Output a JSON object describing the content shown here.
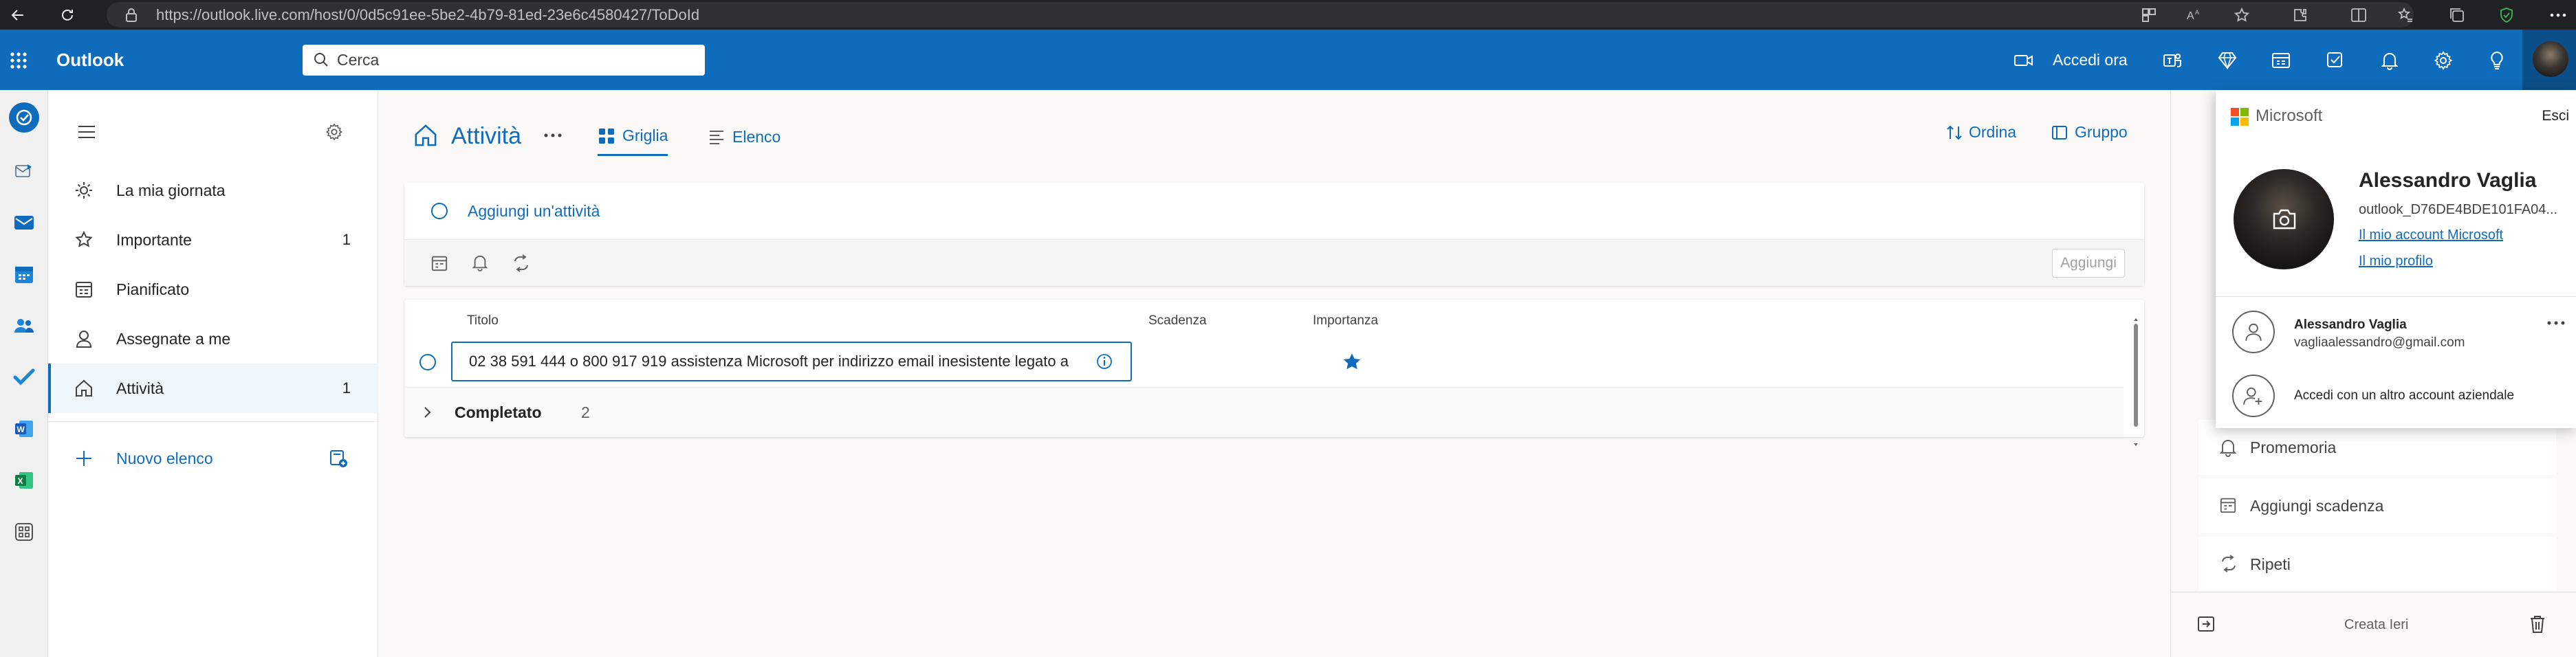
{
  "browser": {
    "url": "https://outlook.live.com/host/0/0d5c91ee-5be2-4b79-81ed-23e6c4580427/ToDoId"
  },
  "header": {
    "app_name": "Outlook",
    "search_placeholder": "Cerca",
    "signin_label": "Accedi ora"
  },
  "nav": {
    "items": [
      {
        "label": "La mia giornata",
        "count": "",
        "icon": "sun-icon"
      },
      {
        "label": "Importante",
        "count": "1",
        "icon": "star-icon"
      },
      {
        "label": "Pianificato",
        "count": "",
        "icon": "calendar-icon"
      },
      {
        "label": "Assegnate a me",
        "count": "",
        "icon": "person-icon"
      },
      {
        "label": "Attività",
        "count": "1",
        "icon": "home-icon",
        "selected": true
      }
    ],
    "new_list_label": "Nuovo elenco"
  },
  "main": {
    "title": "Attività",
    "tabs": [
      {
        "label": "Griglia",
        "active": true
      },
      {
        "label": "Elenco",
        "active": false
      }
    ],
    "sort_label": "Ordina",
    "group_label": "Gruppo",
    "add_task_label": "Aggiungi un'attività",
    "add_button_label": "Aggiungi",
    "columns": [
      "Titolo",
      "Scadenza",
      "Importanza"
    ],
    "task": {
      "title": "02 38 591 444 o 800 917 919 assistenza Microsoft per indirizzo email inesistente legato a",
      "important": true
    },
    "completed": {
      "label": "Completato",
      "count": "2"
    }
  },
  "detail": {
    "items": [
      {
        "label": "Promemoria",
        "icon": "bell-icon"
      },
      {
        "label": "Aggiungi scadenza",
        "icon": "calendar-icon"
      },
      {
        "label": "Ripeti",
        "icon": "repeat-icon"
      }
    ],
    "created": "Creata Ieri"
  },
  "account": {
    "brand": "Microsoft",
    "signout": "Esci",
    "name": "Alessandro Vaglia",
    "email": "outlook_D76DE4BDE101FA04...",
    "link_account": "Il mio account Microsoft",
    "link_profile": "Il mio profilo",
    "other_account": {
      "name": "Alessandro Vaglia",
      "email": "vagliaalessandro@gmail.com"
    },
    "add_account_label": "Accedi con un altro account aziendale"
  },
  "colors": {
    "brand": "#0f6cbd",
    "browser_bg": "#202124"
  }
}
